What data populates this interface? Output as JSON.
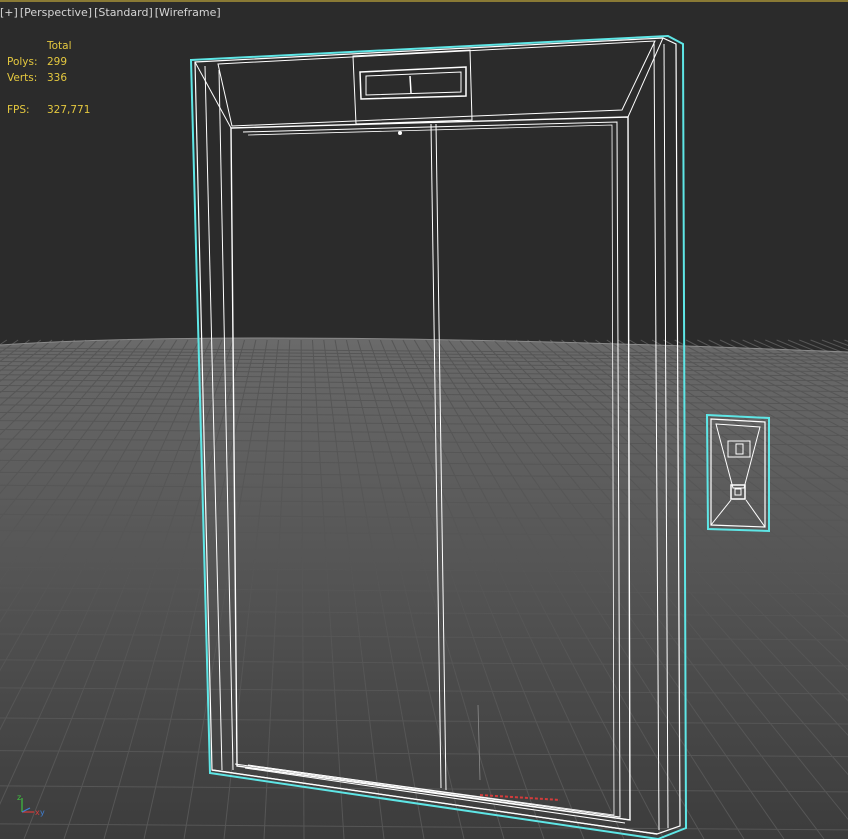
{
  "viewport": {
    "label_parts": [
      "[+]",
      "[Perspective]",
      "[Standard]",
      "[Wireframe]"
    ]
  },
  "stats": {
    "header": "Total",
    "polys_label": "Polys:",
    "polys_value": "299",
    "verts_label": "Verts:",
    "verts_value": "336",
    "fps_label": "FPS:",
    "fps_value": "327,771"
  },
  "colors": {
    "background": "#2b2b2b",
    "grid": "#707070",
    "selection": "#5ee6e6",
    "wire": "#ffffff",
    "stats_text": "#e4c83f"
  },
  "axis_icon": {
    "x": "x",
    "y": "y",
    "z": "z"
  }
}
